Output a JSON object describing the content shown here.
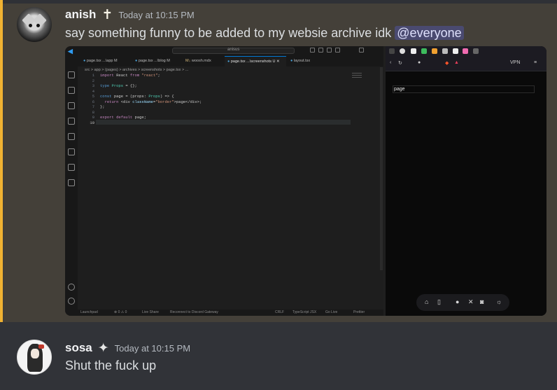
{
  "messages": [
    {
      "username": "anish",
      "role_icon": "✝",
      "timestamp": "Today at 10:15 PM",
      "text": "say something funny to be added to my websie archive idk",
      "mention": "@everyone",
      "highlighted": true
    },
    {
      "username": "sosa",
      "role_icon": "✦",
      "timestamp": "Today at 10:15 PM",
      "text": "Shut the fuck up"
    }
  ],
  "attachment": {
    "editor": {
      "search": "anisus",
      "tabs": [
        "page.tsx ...\\app M",
        "page.tsx ...\\blog M",
        "woosh.mdx",
        "page.tsx ...\\screenshots U",
        "layout.tsx"
      ],
      "breadcrumb": "src > app > (pages) > archives > screenshots > page.tsx > ...",
      "line_numbers": [
        "1",
        "2",
        "3",
        "4",
        "5",
        "6",
        "7",
        "8",
        "9",
        "10"
      ],
      "code": [
        "import React from \"react\";",
        "",
        "type Props = {};",
        "",
        "const page = (props: Props) => {",
        "  return <div className=\"border\">page</div>;",
        "};",
        "",
        "export default page;",
        ""
      ],
      "status": [
        "Launchpad",
        "⊗ 0  ⚠ 0",
        "Live Share",
        "Reconnect to Discord Gateway",
        "CRLF",
        "TypeScript JSX",
        "Go Live",
        "Prettier"
      ]
    },
    "browser": {
      "page_text": "page",
      "vpn_label": "VPN"
    }
  },
  "colors": {
    "mention_bar": "#f0b232",
    "highlight_bg": "#444039",
    "chat_bg": "#313338"
  }
}
